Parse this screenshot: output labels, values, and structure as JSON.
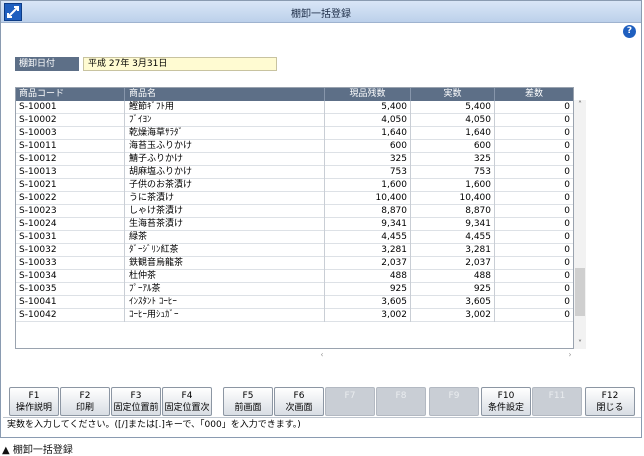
{
  "window": {
    "title": "棚卸一括登録"
  },
  "date_field": {
    "label": "棚卸日付",
    "value": "平成 27年 3月31日"
  },
  "table": {
    "headers": {
      "code": "商品コード",
      "name": "商品名",
      "stock": "現品残数",
      "actual": "実数",
      "diff": "差数"
    },
    "rows": [
      {
        "code": "S-10001",
        "name": "鰹節ｷﾞﾌﾄ用",
        "stock": "5,400",
        "actual": "5,400",
        "diff": "0"
      },
      {
        "code": "S-10002",
        "name": "ﾌﾞｲﾖﾝ",
        "stock": "4,050",
        "actual": "4,050",
        "diff": "0"
      },
      {
        "code": "S-10003",
        "name": "乾燥海草ｻﾗﾀﾞ",
        "stock": "1,640",
        "actual": "1,640",
        "diff": "0"
      },
      {
        "code": "S-10011",
        "name": "海苔玉ふりかけ",
        "stock": "600",
        "actual": "600",
        "diff": "0"
      },
      {
        "code": "S-10012",
        "name": "鯖子ふりかけ",
        "stock": "325",
        "actual": "325",
        "diff": "0"
      },
      {
        "code": "S-10013",
        "name": "胡麻塩ふりかけ",
        "stock": "753",
        "actual": "753",
        "diff": "0"
      },
      {
        "code": "S-10021",
        "name": "子供のお茶漬け",
        "stock": "1,600",
        "actual": "1,600",
        "diff": "0"
      },
      {
        "code": "S-10022",
        "name": "うに茶漬け",
        "stock": "10,400",
        "actual": "10,400",
        "diff": "0"
      },
      {
        "code": "S-10023",
        "name": "しゃけ茶漬け",
        "stock": "8,870",
        "actual": "8,870",
        "diff": "0"
      },
      {
        "code": "S-10024",
        "name": "生海苔茶漬け",
        "stock": "9,341",
        "actual": "9,341",
        "diff": "0"
      },
      {
        "code": "S-10031",
        "name": "緑茶",
        "stock": "4,455",
        "actual": "4,455",
        "diff": "0"
      },
      {
        "code": "S-10032",
        "name": "ﾀﾞｰｼﾞﾘﾝ紅茶",
        "stock": "3,281",
        "actual": "3,281",
        "diff": "0"
      },
      {
        "code": "S-10033",
        "name": "鉄観音烏龍茶",
        "stock": "2,037",
        "actual": "2,037",
        "diff": "0"
      },
      {
        "code": "S-10034",
        "name": "杜仲茶",
        "stock": "488",
        "actual": "488",
        "diff": "0"
      },
      {
        "code": "S-10035",
        "name": "ﾌﾟｰｱﾙ茶",
        "stock": "925",
        "actual": "925",
        "diff": "0"
      },
      {
        "code": "S-10041",
        "name": "ｲﾝｽﾀﾝﾄ ｺｰﾋｰ",
        "stock": "3,605",
        "actual": "3,605",
        "diff": "0"
      },
      {
        "code": "S-10042",
        "name": "ｺｰﾋｰ用ｼｭｶﾞｰ",
        "stock": "3,002",
        "actual": "3,002",
        "diff": "0"
      }
    ]
  },
  "function_keys": [
    {
      "key": "F1",
      "label": "操作説明",
      "enabled": true
    },
    {
      "key": "F2",
      "label": "印刷",
      "enabled": true
    },
    {
      "key": "F3",
      "label": "固定位置前",
      "enabled": true
    },
    {
      "key": "F4",
      "label": "固定位置次",
      "enabled": true
    },
    {
      "key": "F5",
      "label": "前画面",
      "enabled": true
    },
    {
      "key": "F6",
      "label": "次画面",
      "enabled": true
    },
    {
      "key": "F7",
      "label": "",
      "enabled": false
    },
    {
      "key": "F8",
      "label": "",
      "enabled": false
    },
    {
      "key": "F9",
      "label": "",
      "enabled": false
    },
    {
      "key": "F10",
      "label": "条件設定",
      "enabled": true
    },
    {
      "key": "F11",
      "label": "",
      "enabled": false
    },
    {
      "key": "F12",
      "label": "閉じる",
      "enabled": true
    }
  ],
  "status_bar": {
    "text": "実数を入力してください。([/]または[.]キーで、「000」を入力できます。)"
  },
  "caption": "▲ 棚卸一括登録",
  "colors": {
    "header_bg": "#5d6f87",
    "date_bg": "#fffbd2",
    "title_bg": "#bcd0ea"
  },
  "icons": {
    "app": "app-arrows-icon",
    "help": "help-icon"
  }
}
